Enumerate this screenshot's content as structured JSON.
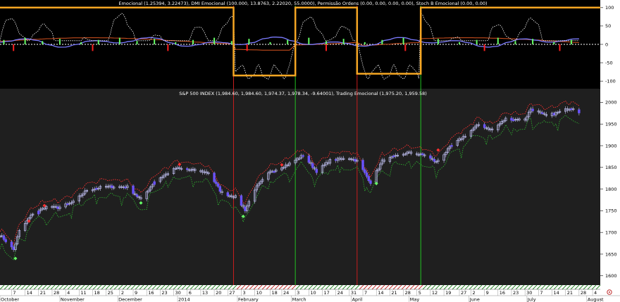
{
  "chart_data": [
    {
      "type": "line",
      "title": "Emocional (1.25394, 3.22473), DMI Emocional (100.000, 13.8763, 2.22020, 55.0000), Permissão Ordens (0.00, 0.00, 0.00, 0.00), Stoch B Emocional (0.00, 0.00)",
      "ylim": [
        -115,
        115
      ],
      "yticks": [
        100,
        50,
        0,
        -50,
        -100
      ],
      "background": "#000000",
      "colors": {
        "step": "#f5a623",
        "dotted": "#ffffff",
        "blue": "#7b7bff",
        "orange": "#d9541f",
        "green": "#66ff66",
        "red": "#ff2020"
      },
      "step_signal": [
        {
          "start": "2013-10-01",
          "value": 100
        },
        {
          "start": "2014-01-30",
          "value": -85
        },
        {
          "start": "2014-03-03",
          "value": 100
        },
        {
          "start": "2014-04-04",
          "value": -80
        },
        {
          "start": "2014-05-07",
          "value": 100
        }
      ]
    },
    {
      "type": "candlestick",
      "title": "S&P 500 INDEX (1,984.60, 1,984.60, 1,974.37, 1,978.34, -9.64001), Trading Emocional (1,975.20, 1,959.58)",
      "ylim": [
        1585,
        2025
      ],
      "yticks": [
        2000,
        1950,
        1900,
        1850,
        1800,
        1750,
        1700,
        1650,
        1600
      ],
      "background": "#1f1f1f",
      "colors": {
        "candle": "#c8c8ff",
        "highlight": "#6a52ff",
        "upper_band": "#ff3030",
        "lower_band": "#2ea82e",
        "vline_red": "#c81e1e",
        "vline_green": "#22c022"
      },
      "close_path": [
        [
          "2013-10-01",
          1695
        ],
        [
          "2013-10-08",
          1660
        ],
        [
          "2013-10-11",
          1703
        ],
        [
          "2013-10-18",
          1744
        ],
        [
          "2013-10-25",
          1759
        ],
        [
          "2013-10-31",
          1757
        ],
        [
          "2013-11-08",
          1770
        ],
        [
          "2013-11-15",
          1798
        ],
        [
          "2013-11-22",
          1804
        ],
        [
          "2013-11-29",
          1806
        ],
        [
          "2013-12-06",
          1805
        ],
        [
          "2013-12-13",
          1775
        ],
        [
          "2013-12-20",
          1818
        ],
        [
          "2013-12-31",
          1848
        ],
        [
          "2014-01-10",
          1843
        ],
        [
          "2014-01-17",
          1838
        ],
        [
          "2014-01-24",
          1790
        ],
        [
          "2014-01-31",
          1782
        ],
        [
          "2014-02-05",
          1752
        ],
        [
          "2014-02-10",
          1800
        ],
        [
          "2014-02-18",
          1840
        ],
        [
          "2014-02-28",
          1859
        ],
        [
          "2014-03-07",
          1878
        ],
        [
          "2014-03-14",
          1841
        ],
        [
          "2014-03-21",
          1866
        ],
        [
          "2014-03-31",
          1872
        ],
        [
          "2014-04-04",
          1865
        ],
        [
          "2014-04-11",
          1815
        ],
        [
          "2014-04-17",
          1865
        ],
        [
          "2014-04-30",
          1884
        ],
        [
          "2014-05-09",
          1878
        ],
        [
          "2014-05-15",
          1862
        ],
        [
          "2014-05-23",
          1900
        ],
        [
          "2014-05-30",
          1924
        ],
        [
          "2014-06-06",
          1949
        ],
        [
          "2014-06-13",
          1936
        ],
        [
          "2014-06-20",
          1962
        ],
        [
          "2014-06-30",
          1960
        ],
        [
          "2014-07-03",
          1985
        ],
        [
          "2014-07-11",
          1968
        ],
        [
          "2014-07-18",
          1978
        ],
        [
          "2014-07-24",
          1988
        ],
        [
          "2014-07-28",
          1978
        ]
      ],
      "markers": [
        {
          "date": "2013-10-09",
          "value": 1640,
          "color": "#66ff66"
        },
        {
          "date": "2013-10-16",
          "value": 1726,
          "color": "#ff3030"
        },
        {
          "date": "2013-10-24",
          "value": 1762,
          "color": "#ff3030"
        },
        {
          "date": "2013-12-13",
          "value": 1768,
          "color": "#66ff66"
        },
        {
          "date": "2014-01-02",
          "value": 1857,
          "color": "#ff3030"
        },
        {
          "date": "2014-02-04",
          "value": 1737,
          "color": "#66ff66"
        },
        {
          "date": "2014-02-24",
          "value": 1856,
          "color": "#ff3030"
        },
        {
          "date": "2014-04-14",
          "value": 1813,
          "color": "#66ff66"
        },
        {
          "date": "2014-05-16",
          "value": 1890,
          "color": "#ff3030"
        }
      ],
      "signal_lines": [
        {
          "date": "2014-01-30",
          "color": "#c81e1e"
        },
        {
          "date": "2014-03-03",
          "color": "#22c022"
        },
        {
          "date": "2014-04-04",
          "color": "#c81e1e"
        },
        {
          "date": "2014-05-07",
          "color": "#22c022"
        }
      ]
    }
  ],
  "xaxis": {
    "day_labels": [
      {
        "text": "7",
        "date": "2013-10-07"
      },
      {
        "text": "14",
        "date": "2013-10-14"
      },
      {
        "text": "21",
        "date": "2013-10-21"
      },
      {
        "text": "28",
        "date": "2013-10-28"
      },
      {
        "text": "4",
        "date": "2013-11-04"
      },
      {
        "text": "11",
        "date": "2013-11-11"
      },
      {
        "text": "18",
        "date": "2013-11-18"
      },
      {
        "text": "25",
        "date": "2013-11-25"
      },
      {
        "text": "2",
        "date": "2013-12-02"
      },
      {
        "text": "9",
        "date": "2013-12-09"
      },
      {
        "text": "16",
        "date": "2013-12-16"
      },
      {
        "text": "23",
        "date": "2013-12-23"
      },
      {
        "text": "30",
        "date": "2013-12-30"
      },
      {
        "text": "6",
        "date": "2014-01-06"
      },
      {
        "text": "13",
        "date": "2014-01-13"
      },
      {
        "text": "20",
        "date": "2014-01-20"
      },
      {
        "text": "27",
        "date": "2014-01-27"
      },
      {
        "text": "3",
        "date": "2014-02-03"
      },
      {
        "text": "10",
        "date": "2014-02-10"
      },
      {
        "text": "18",
        "date": "2014-02-18"
      },
      {
        "text": "24",
        "date": "2014-02-24"
      },
      {
        "text": "3",
        "date": "2014-03-03"
      },
      {
        "text": "10",
        "date": "2014-03-10"
      },
      {
        "text": "17",
        "date": "2014-03-17"
      },
      {
        "text": "24",
        "date": "2014-03-24"
      },
      {
        "text": "31",
        "date": "2014-03-31"
      },
      {
        "text": "7",
        "date": "2014-04-07"
      },
      {
        "text": "14",
        "date": "2014-04-14"
      },
      {
        "text": "21",
        "date": "2014-04-21"
      },
      {
        "text": "28",
        "date": "2014-04-28"
      },
      {
        "text": "5",
        "date": "2014-05-05"
      },
      {
        "text": "12",
        "date": "2014-05-12"
      },
      {
        "text": "19",
        "date": "2014-05-19"
      },
      {
        "text": "27",
        "date": "2014-05-27"
      },
      {
        "text": "2",
        "date": "2014-06-02"
      },
      {
        "text": "9",
        "date": "2014-06-09"
      },
      {
        "text": "16",
        "date": "2014-06-16"
      },
      {
        "text": "23",
        "date": "2014-06-23"
      },
      {
        "text": "30",
        "date": "2014-06-30"
      },
      {
        "text": "7",
        "date": "2014-07-07"
      },
      {
        "text": "14",
        "date": "2014-07-14"
      },
      {
        "text": "21",
        "date": "2014-07-21"
      },
      {
        "text": "28",
        "date": "2014-07-28"
      },
      {
        "text": "4",
        "date": "2014-08-04"
      }
    ],
    "month_labels": [
      {
        "text": "October",
        "date": "2013-10-01"
      },
      {
        "text": "November",
        "date": "2013-11-01"
      },
      {
        "text": "December",
        "date": "2013-12-01"
      },
      {
        "text": "2014",
        "date": "2014-01-01"
      },
      {
        "text": "February",
        "date": "2014-02-01"
      },
      {
        "text": "March",
        "date": "2014-03-01"
      },
      {
        "text": "April",
        "date": "2014-04-01"
      },
      {
        "text": "May",
        "date": "2014-05-01"
      },
      {
        "text": "June",
        "date": "2014-06-01"
      },
      {
        "text": "July",
        "date": "2014-07-01"
      },
      {
        "text": "August",
        "date": "2014-08-01"
      }
    ],
    "range": [
      "2013-10-01",
      "2014-08-08"
    ]
  }
}
